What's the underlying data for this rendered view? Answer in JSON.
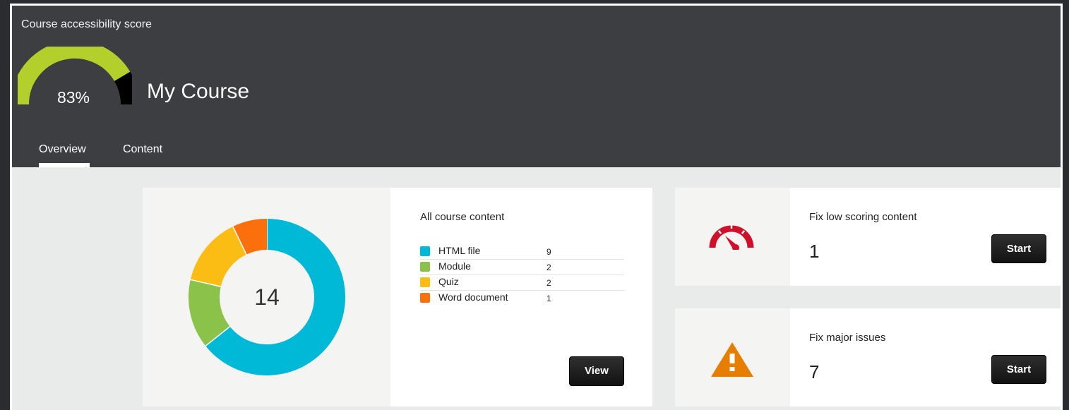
{
  "header": {
    "score_label": "Course accessibility score",
    "score_percent": 83,
    "score_text": "83%",
    "course_title": "My Course",
    "tabs": [
      {
        "label": "Overview",
        "active": true
      },
      {
        "label": "Content",
        "active": false
      }
    ]
  },
  "colors": {
    "gauge_fill": "#b3cf2b",
    "gauge_rest": "#000000",
    "header_bg": "#3d3e41",
    "speedometer": "#d0102b",
    "warning": "#e67e00"
  },
  "content_summary": {
    "title": "All course content",
    "total": "14",
    "items": [
      {
        "name": "HTML file",
        "count": "9",
        "color": "#00b9d6"
      },
      {
        "name": "Module",
        "count": "2",
        "color": "#8bc34a"
      },
      {
        "name": "Quiz",
        "count": "2",
        "color": "#fbbd13"
      },
      {
        "name": "Word document",
        "count": "1",
        "color": "#fb6f0d"
      }
    ],
    "view_label": "View"
  },
  "chart_data": {
    "type": "pie",
    "categories": [
      "HTML file",
      "Module",
      "Quiz",
      "Word document"
    ],
    "values": [
      9,
      2,
      2,
      1
    ],
    "center_label": "14"
  },
  "fix_cards": [
    {
      "title": "Fix low scoring content",
      "count": "1",
      "icon": "speedometer-icon",
      "button": "Start"
    },
    {
      "title": "Fix major issues",
      "count": "7",
      "icon": "warning-icon",
      "button": "Start"
    }
  ]
}
